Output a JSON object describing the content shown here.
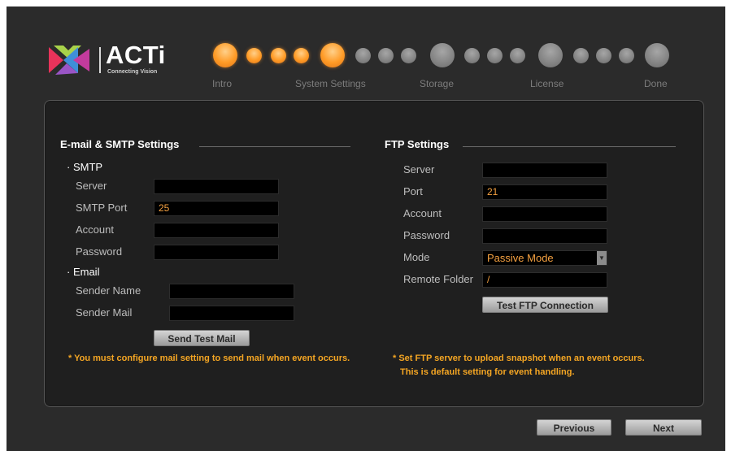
{
  "brand": {
    "name": "ACTi",
    "tagline": "Connecting Vision"
  },
  "steps": {
    "labels": [
      "Intro",
      "System Settings",
      "Storage",
      "License",
      "Done"
    ],
    "current": "System Settings"
  },
  "email": {
    "title": "E-mail & SMTP Settings",
    "smtp_title": "SMTP",
    "server_label": "Server",
    "server_value": "",
    "port_label": "SMTP Port",
    "port_value": "25",
    "account_label": "Account",
    "account_value": "",
    "password_label": "Password",
    "password_value": "",
    "email_title": "Email",
    "sender_name_label": "Sender Name",
    "sender_name_value": "",
    "sender_mail_label": "Sender Mail",
    "sender_mail_value": "",
    "send_test_label": "Send Test Mail",
    "note": "* You must configure mail setting to send mail when event occurs."
  },
  "ftp": {
    "title": "FTP Settings",
    "server_label": "Server",
    "server_value": "",
    "port_label": "Port",
    "port_value": "21",
    "account_label": "Account",
    "account_value": "",
    "password_label": "Password",
    "password_value": "",
    "mode_label": "Mode",
    "mode_value": "Passive Mode",
    "remote_label": "Remote Folder",
    "remote_value": "/",
    "test_label": "Test FTP Connection",
    "note_line1": "* Set FTP server to upload snapshot when an event occurs.",
    "note_line2": "This is default setting for event handling."
  },
  "footer": {
    "previous_label": "Previous",
    "next_label": "Next"
  },
  "colors": {
    "accent": "#f5a623",
    "active_step": "#ff9b26",
    "inactive_step": "#7d7d7d",
    "background": "#2b2b2b"
  }
}
